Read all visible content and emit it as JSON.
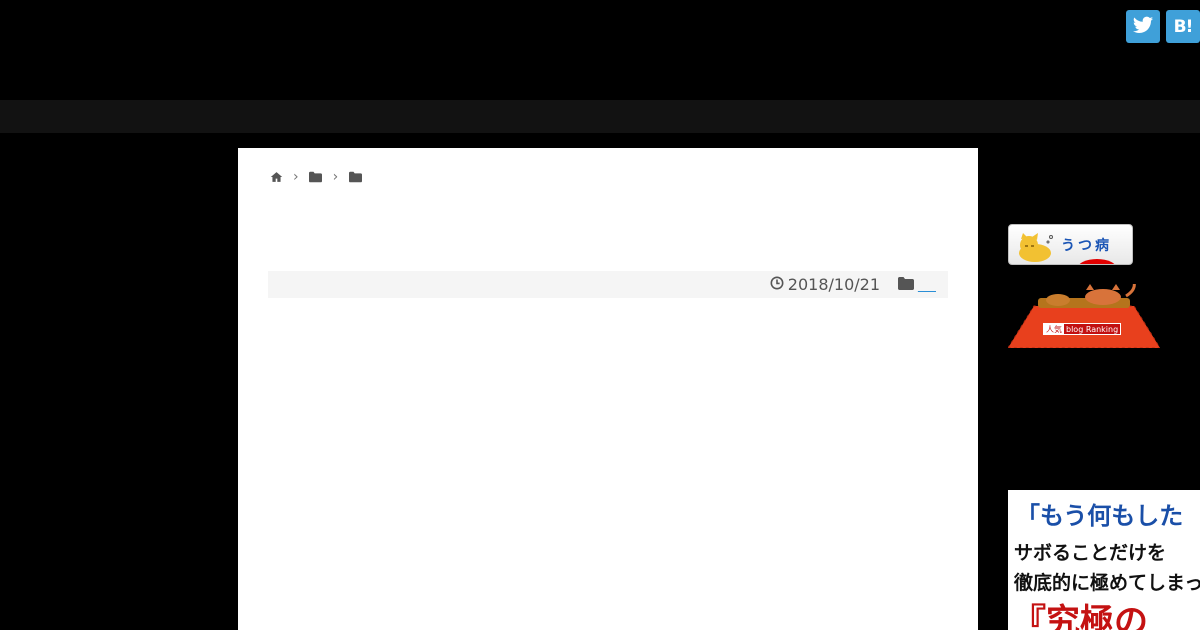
{
  "share": {
    "twitter_icon": "twitter-bird-icon",
    "hatena_label": "B!"
  },
  "breadcrumb": {
    "home_icon": "home-icon",
    "separator": "›",
    "folder_icon": "folder-icon"
  },
  "post_meta": {
    "date": "2018/10/21",
    "clock_icon": "clock-icon",
    "category_icon": "folder-icon",
    "category_link": "__"
  },
  "sidebar": {
    "banner1_text": "うつ病",
    "banner2_popular": "人気",
    "banner2_brand": "blog Ranking",
    "ad_line1": "「もう何もした",
    "ad_line2": "サボることだけを",
    "ad_line3": "徹底的に極めてしまっ",
    "ad_line4": "『究極の"
  },
  "colors": {
    "background": "#000000",
    "nav": "#121212",
    "card": "#ffffff",
    "share": "#3fa0d9",
    "link": "#2a8fd6",
    "meta_bar": "#f5f5f5"
  }
}
